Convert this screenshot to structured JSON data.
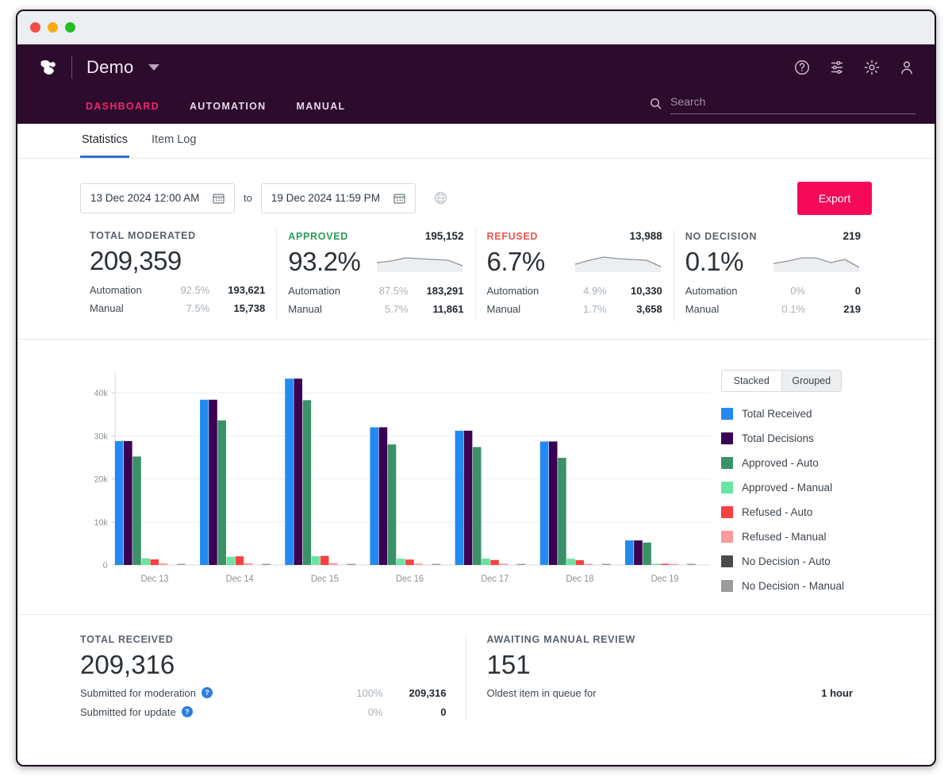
{
  "window": {
    "controls": [
      "close",
      "minimize",
      "maximize"
    ]
  },
  "header": {
    "brand": "Demo",
    "nav": [
      {
        "label": "DASHBOARD",
        "active": true
      },
      {
        "label": "AUTOMATION",
        "active": false
      },
      {
        "label": "MANUAL",
        "active": false
      }
    ],
    "icons": [
      "help-icon",
      "tune-icon",
      "gear-icon",
      "account-icon"
    ],
    "search": {
      "value": "",
      "placeholder": "Search"
    }
  },
  "tabs": [
    {
      "label": "Statistics",
      "active": true
    },
    {
      "label": "Item Log",
      "active": false
    }
  ],
  "toolbar": {
    "date_from": "13 Dec 2024 12:00 AM",
    "date_to": "19 Dec 2024 11:59 PM",
    "to_label": "to",
    "timezone_icon": "globe-icon",
    "export_label": "Export"
  },
  "kpis": [
    {
      "title": "TOTAL MODERATED",
      "total": "",
      "big": "209,359",
      "has_spark": false,
      "accent": "#59636d",
      "rows": [
        {
          "label": "Automation",
          "pct": "92.5%",
          "value": "193,621"
        },
        {
          "label": "Manual",
          "pct": "7.5%",
          "value": "15,738"
        }
      ]
    },
    {
      "title": "APPROVED",
      "total": "195,152",
      "big": "93.2%",
      "has_spark": true,
      "accent": "#2a9d5c",
      "rows": [
        {
          "label": "Automation",
          "pct": "87.5%",
          "value": "183,291"
        },
        {
          "label": "Manual",
          "pct": "5.7%",
          "value": "11,861"
        }
      ]
    },
    {
      "title": "REFUSED",
      "total": "13,988",
      "big": "6.7%",
      "has_spark": true,
      "accent": "#f2544f",
      "rows": [
        {
          "label": "Automation",
          "pct": "4.9%",
          "value": "10,330"
        },
        {
          "label": "Manual",
          "pct": "1.7%",
          "value": "3,658"
        }
      ]
    },
    {
      "title": "NO DECISION",
      "total": "219",
      "big": "0.1%",
      "has_spark": true,
      "accent": "#59636d",
      "rows": [
        {
          "label": "Automation",
          "pct": "0%",
          "value": "0"
        },
        {
          "label": "Manual",
          "pct": "0.1%",
          "value": "219"
        }
      ]
    }
  ],
  "chart_controls": {
    "modes": [
      {
        "label": "Stacked",
        "active": true
      },
      {
        "label": "Grouped",
        "active": false
      }
    ]
  },
  "chart_data": {
    "type": "bar",
    "title": "",
    "xlabel": "",
    "ylabel": "",
    "ylim": [
      0,
      45000
    ],
    "yticks": [
      0,
      10000,
      20000,
      30000,
      40000
    ],
    "ytick_labels": [
      "0",
      "10k",
      "20k",
      "30k",
      "40k"
    ],
    "grid": true,
    "legend_position": "right",
    "categories": [
      "Dec 13",
      "Dec 14",
      "Dec 15",
      "Dec 16",
      "Dec 17",
      "Dec 18",
      "Dec 19"
    ],
    "series": [
      {
        "name": "Total Received",
        "color": "#2489f2",
        "values": [
          28800,
          38400,
          43300,
          32000,
          31200,
          28700,
          5700
        ]
      },
      {
        "name": "Total Decisions",
        "color": "#3b0152",
        "values": [
          28800,
          38400,
          43300,
          32000,
          31200,
          28700,
          5700
        ]
      },
      {
        "name": "Approved - Auto",
        "color": "#3b9168",
        "values": [
          25200,
          33600,
          38300,
          28000,
          27400,
          24900,
          5200
        ]
      },
      {
        "name": "Approved - Manual",
        "color": "#68e5a0",
        "values": [
          1550,
          1900,
          2050,
          1450,
          1500,
          1450,
          200
        ]
      },
      {
        "name": "Refused - Auto",
        "color": "#fa4040",
        "values": [
          1300,
          2000,
          2100,
          1250,
          1150,
          1100,
          120
        ]
      },
      {
        "name": "Refused - Manual",
        "color": "#fa9a9a",
        "values": [
          320,
          380,
          400,
          300,
          280,
          260,
          90
        ]
      },
      {
        "name": "No Decision - Auto",
        "color": "#4a4a4a",
        "values": [
          0,
          0,
          0,
          0,
          0,
          0,
          0
        ]
      },
      {
        "name": "No Decision - Manual",
        "color": "#9b9b9b",
        "values": [
          30,
          30,
          30,
          30,
          30,
          30,
          10
        ]
      }
    ]
  },
  "bottom": [
    {
      "title": "TOTAL RECEIVED",
      "big": "209,316",
      "rows": [
        {
          "label": "Submitted for moderation",
          "help": "?",
          "pct": "100%",
          "value": "209,316"
        },
        {
          "label": "Submitted for update",
          "help": "?",
          "pct": "0%",
          "value": "0"
        }
      ]
    },
    {
      "title": "AWAITING MANUAL REVIEW",
      "big": "151",
      "rows": [
        {
          "label": "Oldest item in queue for",
          "help": "",
          "pct": "",
          "value": "1 hour"
        }
      ]
    }
  ],
  "colors": {
    "header_bg": "#2c0b2d",
    "accent_pink": "#f1256b",
    "export_pink": "#f50a5a",
    "tab_underline": "#2f6fd0"
  }
}
